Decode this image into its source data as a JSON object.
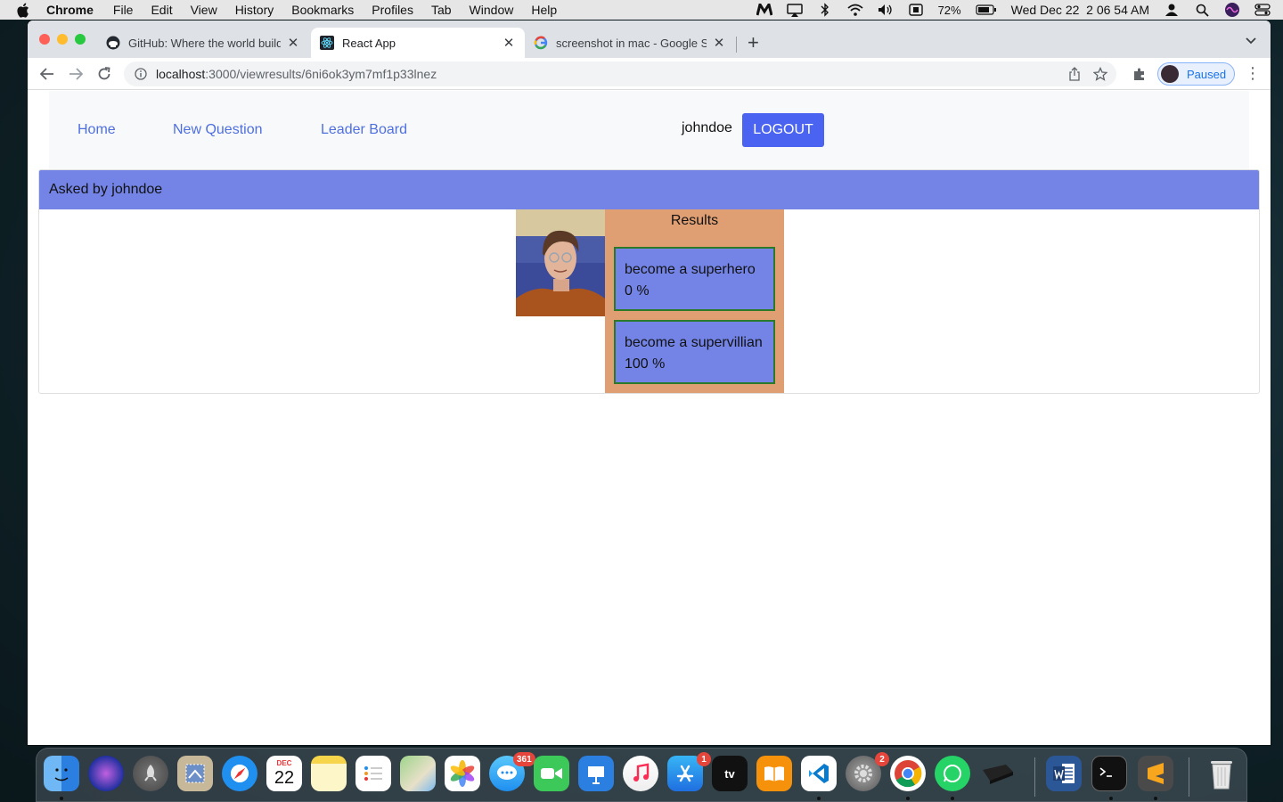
{
  "menubar": {
    "app_name": "Chrome",
    "items": [
      "File",
      "Edit",
      "View",
      "History",
      "Bookmarks",
      "Profiles",
      "Tab",
      "Window",
      "Help"
    ],
    "battery": "72%",
    "datetime": "Wed Dec 22  2 06 54 AM"
  },
  "browser": {
    "tabs": [
      {
        "title": "GitHub: Where the world build",
        "favicon": "github-icon"
      },
      {
        "title": "React App",
        "favicon": "react-icon"
      },
      {
        "title": "screenshot in mac - Google Se",
        "favicon": "google-icon"
      }
    ],
    "url_host": "localhost",
    "url_path": ":3000/viewresults/6ni6ok3ym7mf1p33lnez",
    "profile_label": "Paused"
  },
  "app": {
    "nav": {
      "home": "Home",
      "new_question": "New Question",
      "leader_board": "Leader Board",
      "username": "johndoe",
      "logout": "LOGOUT"
    },
    "question": {
      "asked_by": "Asked by johndoe",
      "results_title": "Results",
      "options": [
        {
          "text": "become a superhero",
          "percent": "0 %"
        },
        {
          "text": "become a supervillian",
          "percent": "100 %"
        }
      ]
    }
  },
  "dock": {
    "calendar_month": "DEC",
    "calendar_day": "22",
    "messages_badge": "361",
    "appstore_badge": "1",
    "settings_badge": "2",
    "tv_label": "tv"
  }
}
